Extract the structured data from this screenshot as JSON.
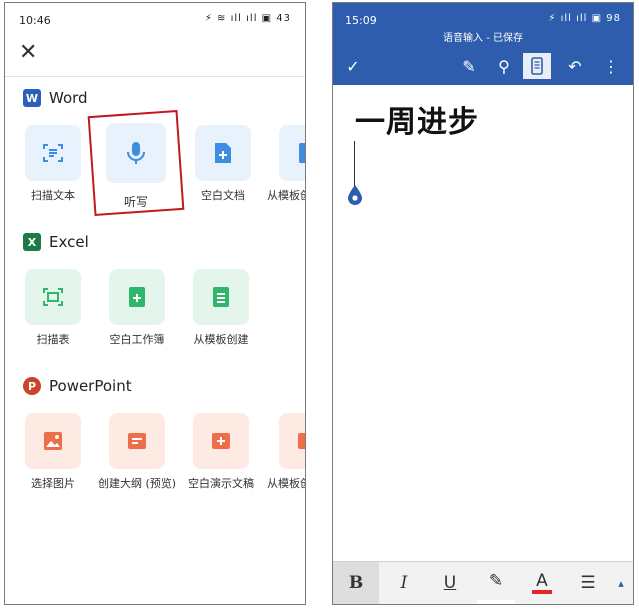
{
  "left_phone": {
    "status": {
      "time": "10:46",
      "icons": "⚡ ≋ ıll ıll ▣ 43"
    },
    "close_glyph": "✕",
    "sections": [
      {
        "app": "Word",
        "logo_letter": "W",
        "tiles": [
          "扫描文本",
          "听写",
          "空白文档",
          "从模板创建"
        ]
      },
      {
        "app": "Excel",
        "logo_letter": "X",
        "tiles": [
          "扫描表",
          "空白工作簿",
          "从模板创建"
        ]
      },
      {
        "app": "PowerPoint",
        "logo_letter": "P",
        "tiles": [
          "选择图片",
          "创建大纲 (预览)",
          "空白演示文稿",
          "从模板创建"
        ]
      }
    ]
  },
  "right_phone": {
    "status": {
      "time": "15:09",
      "icons": "⚡ ıll ıll ▣ 98"
    },
    "title": "语音输入 - 已保存",
    "toolbar": {
      "check": "✓",
      "pen": "✎",
      "search": "⚲",
      "undo": "↶",
      "more": "⋮"
    },
    "document": {
      "heading": "一周进步"
    },
    "format": {
      "bold": "B",
      "italic": "I",
      "underline": "U",
      "highlight": "✎",
      "font_color": "A",
      "list": "☰",
      "expand": "▴"
    }
  },
  "colors": {
    "word": "#2b5fbd",
    "excel": "#1d7a45",
    "powerpoint": "#c8452c",
    "toolbar": "#2e5dae",
    "highlight_box": "#c0191f"
  }
}
